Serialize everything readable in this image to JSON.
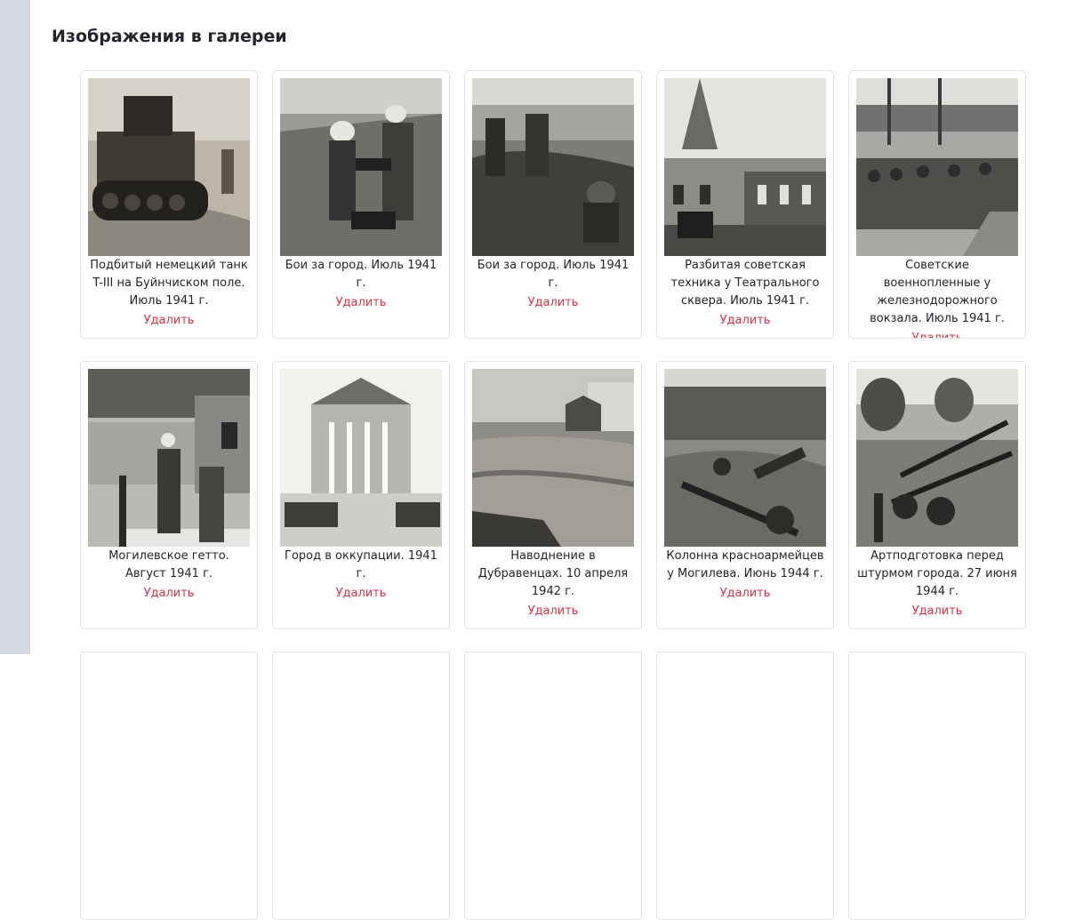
{
  "page": {
    "title": "Изображения в галереи"
  },
  "photos": [
    {
      "caption": "Подбитый немецкий танк T-III на Буйнчиском поле. Июль 1941 г.",
      "delete_label": "Удалить"
    },
    {
      "caption": "Бои за город. Июль 1941 г.",
      "delete_label": "Удалить"
    },
    {
      "caption": "Бои за город. Июль 1941 г.",
      "delete_label": "Удалить"
    },
    {
      "caption": "Разбитая советская техника у Театрального сквера. Июль 1941 г.",
      "delete_label": "Удалить"
    },
    {
      "caption": "Советские военнопленные у железнодорожного вокзала. Июль 1941 г.",
      "delete_label": "Удалить"
    },
    {
      "caption": "Могилевское гетто. Август 1941 г.",
      "delete_label": "Удалить"
    },
    {
      "caption": "Город в оккупации. 1941 г.",
      "delete_label": "Удалить"
    },
    {
      "caption": "Наводнение в Дубравенцах. 10 апреля 1942 г.",
      "delete_label": "Удалить"
    },
    {
      "caption": "Колонна красноармейцев у Могилева. Июнь 1944 г.",
      "delete_label": "Удалить"
    },
    {
      "caption": "Артподготовка перед штурмом города. 27 июня 1944 г.",
      "delete_label": "Удалить"
    }
  ],
  "colors": {
    "delete_link": "#dc3545",
    "side_strip": "#d5d9e0",
    "card_border": "#dfe2e6"
  }
}
